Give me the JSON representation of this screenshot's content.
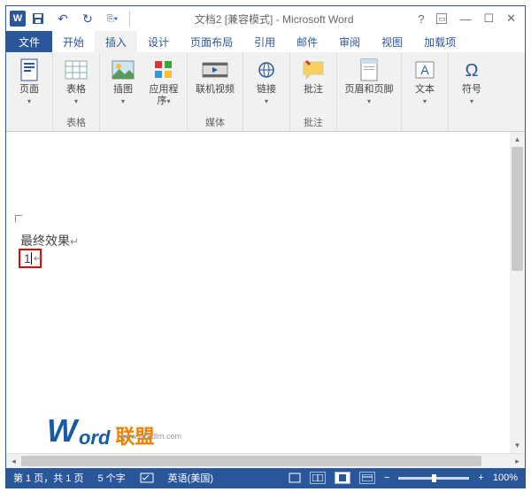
{
  "title": "文档2 [兼容模式] - Microsoft Word",
  "qat": {
    "save": "💾",
    "undo": "↶",
    "redo": "↻",
    "misc": "⎘"
  },
  "tabs": {
    "file": "文件",
    "items": [
      "开始",
      "插入",
      "设计",
      "页面布局",
      "引用",
      "邮件",
      "审阅",
      "视图",
      "加载项"
    ],
    "active_index": 1
  },
  "ribbon": {
    "groups": [
      {
        "label": "",
        "buttons": [
          {
            "name": "pages",
            "label": "页面",
            "icon": "page"
          }
        ]
      },
      {
        "label": "表格",
        "buttons": [
          {
            "name": "tables",
            "label": "表格",
            "icon": "table"
          }
        ]
      },
      {
        "label": "",
        "buttons": [
          {
            "name": "illustrations",
            "label": "插图",
            "icon": "picture"
          },
          {
            "name": "apps",
            "label": "应用程\n序",
            "icon": "apps"
          }
        ]
      },
      {
        "label": "媒体",
        "buttons": [
          {
            "name": "online-video",
            "label": "联机视频",
            "icon": "video"
          }
        ]
      },
      {
        "label": "",
        "buttons": [
          {
            "name": "links",
            "label": "链接",
            "icon": "link"
          }
        ]
      },
      {
        "label": "批注",
        "buttons": [
          {
            "name": "comments",
            "label": "批注",
            "icon": "comment"
          }
        ]
      },
      {
        "label": "",
        "buttons": [
          {
            "name": "header-footer",
            "label": "页眉和页脚",
            "icon": "header"
          }
        ]
      },
      {
        "label": "",
        "buttons": [
          {
            "name": "text",
            "label": "文本",
            "icon": "text"
          }
        ]
      },
      {
        "label": "",
        "buttons": [
          {
            "name": "symbols",
            "label": "符号",
            "icon": "omega"
          }
        ]
      }
    ]
  },
  "document": {
    "line1": "最终效果",
    "redbox_content": "1"
  },
  "statusbar": {
    "page_info": "第 1 页，共 1 页",
    "word_count": "5 个字",
    "spell": "",
    "language": "英语(美国)",
    "zoom": "100%"
  },
  "watermark": {
    "w": "W",
    "ord": "ord",
    "url": "www.wordlm.com",
    "cn": "联盟"
  }
}
